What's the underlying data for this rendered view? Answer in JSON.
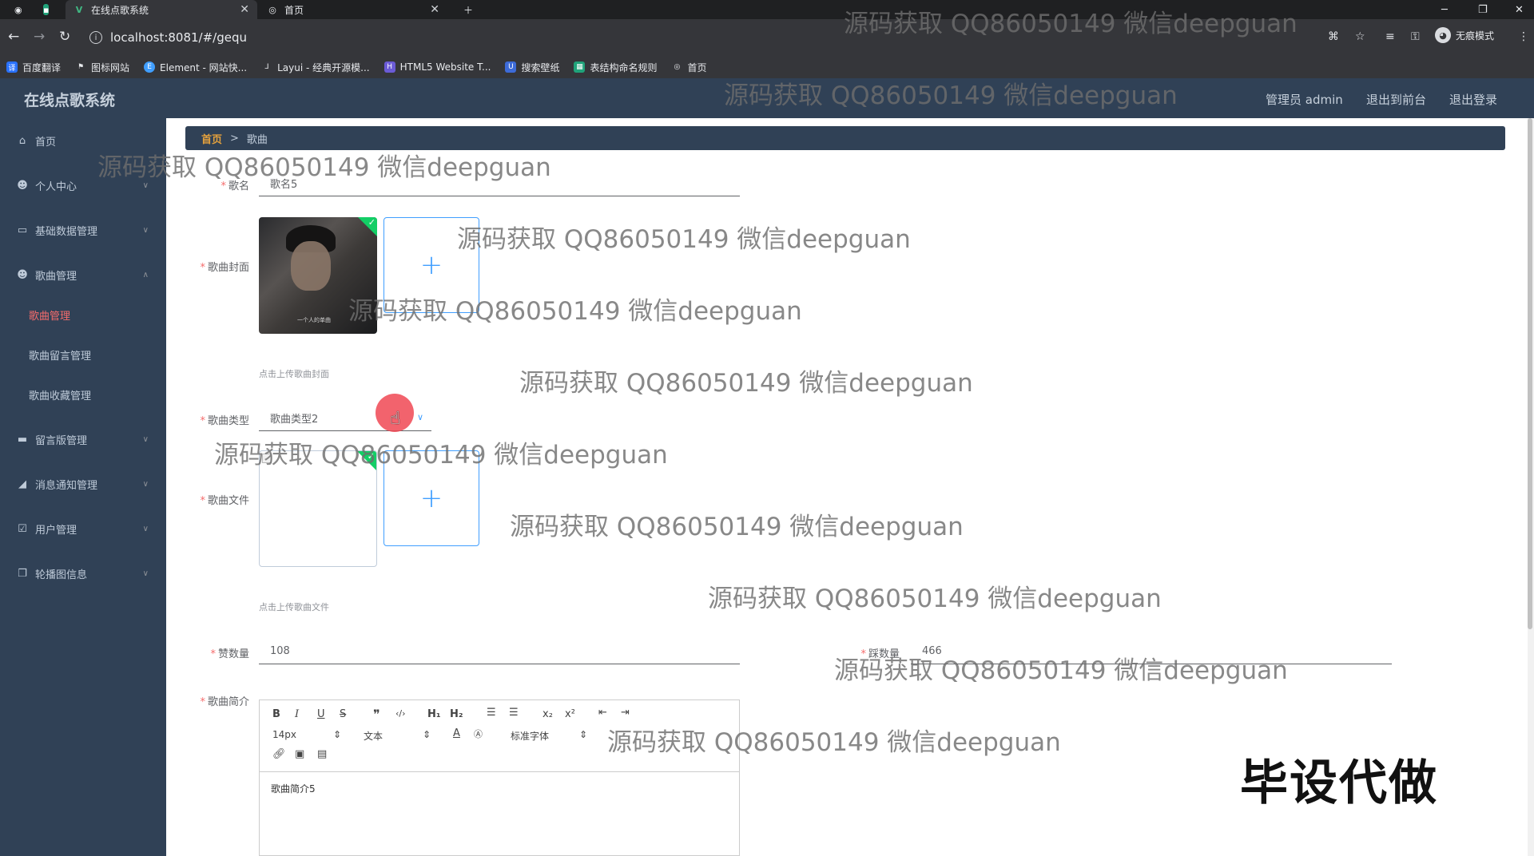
{
  "browser": {
    "tabs": [
      {
        "title": "在线点歌系统",
        "active": true
      },
      {
        "title": "首页",
        "active": false
      }
    ],
    "url": "localhost:8081/#/gequ",
    "incognito_label": "无痕模式",
    "bookmarks": [
      "百度翻译",
      "图标网站",
      "Element - 网站快...",
      "Layui - 经典开源模...",
      "HTML5 Website T...",
      "搜索壁纸",
      "表结构命名规则",
      "首页"
    ]
  },
  "header": {
    "title": "在线点歌系统",
    "user_label": "管理员 admin",
    "front_link": "退出到前台",
    "logout_link": "退出登录"
  },
  "sidebar": {
    "items": [
      {
        "label": "首页",
        "icon": "home-icon"
      },
      {
        "label": "个人中心",
        "icon": "user-icon"
      },
      {
        "label": "基础数据管理",
        "icon": "grid-icon"
      },
      {
        "label": "歌曲管理",
        "icon": "user-icon",
        "expanded": true,
        "children": [
          {
            "label": "歌曲管理",
            "active": true
          },
          {
            "label": "歌曲留言管理"
          },
          {
            "label": "歌曲收藏管理"
          }
        ]
      },
      {
        "label": "留言版管理",
        "icon": "briefcase-icon"
      },
      {
        "label": "消息通知管理",
        "icon": "megaphone-icon"
      },
      {
        "label": "用户管理",
        "icon": "checkbox-icon"
      },
      {
        "label": "轮播图信息",
        "icon": "copy-icon"
      }
    ]
  },
  "breadcrumb": {
    "home": "首页",
    "separator": ">",
    "current": "歌曲"
  },
  "form": {
    "name": {
      "label": "歌名",
      "value": "歌名5"
    },
    "cover": {
      "label": "歌曲封面",
      "hint": "点击上传歌曲封面",
      "caption": "一个人的单曲"
    },
    "type": {
      "label": "歌曲类型",
      "value": "歌曲类型2"
    },
    "file": {
      "label": "歌曲文件",
      "hint": "点击上传歌曲文件"
    },
    "likes": {
      "label": "赞数量",
      "value": "108"
    },
    "dislikes": {
      "label": "踩数量",
      "value": "466"
    },
    "intro": {
      "label": "歌曲简介",
      "value": "歌曲简介5"
    }
  },
  "editor": {
    "font_size": "14px",
    "text_style": "文本",
    "font_family": "标准字体"
  },
  "watermark": "源码获取 QQ86050149 微信deepguan",
  "stamp": "毕设代做"
}
